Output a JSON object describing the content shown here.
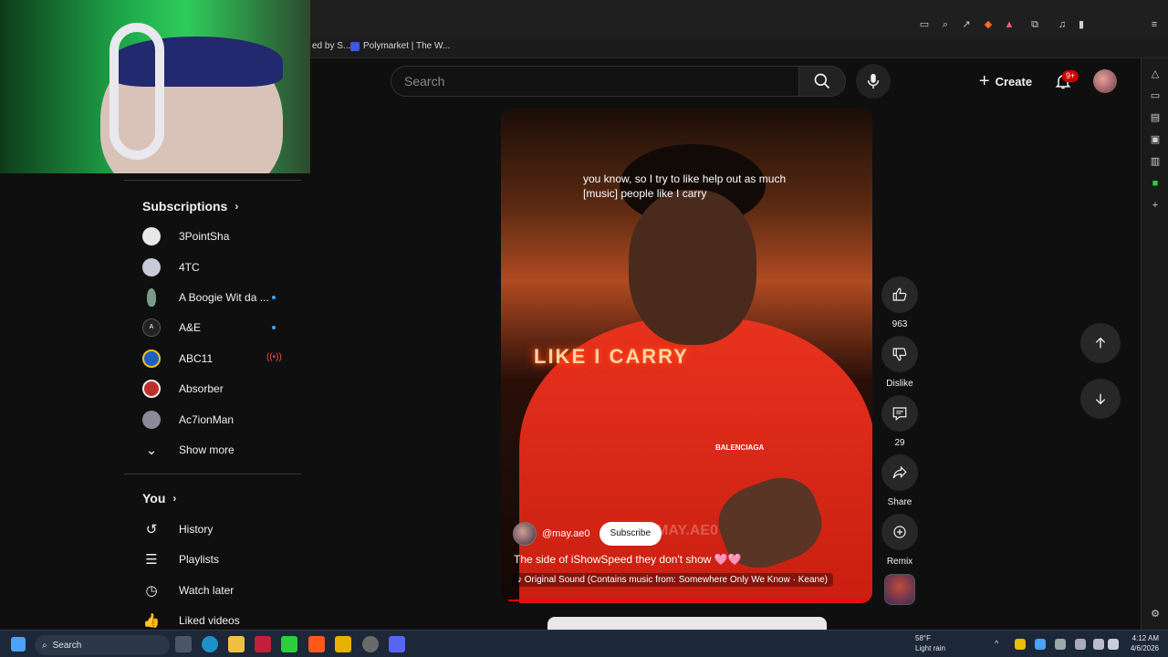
{
  "browser": {
    "bookmarks": [
      {
        "label": "ed by S..."
      },
      {
        "label": "Polymarket | The W..."
      }
    ]
  },
  "header": {
    "search_placeholder": "Search",
    "create_label": "Create",
    "notification_count": "9+"
  },
  "sidebar": {
    "subscriptions_title": "Subscriptions",
    "subscriptions": [
      {
        "label": "3PointSha",
        "color": "#e8e8e8",
        "indicator": ""
      },
      {
        "label": "4TC",
        "color": "#c9c9d8",
        "indicator": ""
      },
      {
        "label": "A Boogie Wit da ...",
        "color": "#7a9a8a",
        "indicator": "new"
      },
      {
        "label": "A&E",
        "color": "#222222",
        "indicator": "new"
      },
      {
        "label": "ABC11",
        "color": "#1f5fbf",
        "indicator": "live"
      },
      {
        "label": "Absorber",
        "color": "#c0302a",
        "indicator": ""
      },
      {
        "label": "Ac7ionMan",
        "color": "#8a8a9a",
        "indicator": ""
      }
    ],
    "show_more_label": "Show more",
    "you_title": "You",
    "you_items": [
      {
        "label": "History",
        "icon": "history-icon"
      },
      {
        "label": "Playlists",
        "icon": "playlists-icon"
      },
      {
        "label": "Watch later",
        "icon": "watch-later-icon"
      },
      {
        "label": "Liked videos",
        "icon": "liked-videos-icon"
      }
    ]
  },
  "short": {
    "caption": "you know, so I try to like help out as much [music] people like I carry",
    "overlay_text": "LIKE I CARRY",
    "watermark": "MAY.AE0",
    "brand": "BALENCIAGA",
    "channel": "@may.ae0",
    "subscribe_label": "Subscribe",
    "title": "The side of iShowSpeed they don't show 🩷🩷",
    "sound": "Original Sound (Contains music from: Somewhere Only We Know · Keane)"
  },
  "actions": {
    "like_count": "963",
    "dislike_label": "Dislike",
    "comment_count": "29",
    "share_label": "Share",
    "remix_label": "Remix"
  },
  "taskbar": {
    "search_label": "Search",
    "weather_temp": "58°F",
    "weather_desc": "Light rain",
    "time": "4:12 AM",
    "date": "4/6/2026"
  }
}
